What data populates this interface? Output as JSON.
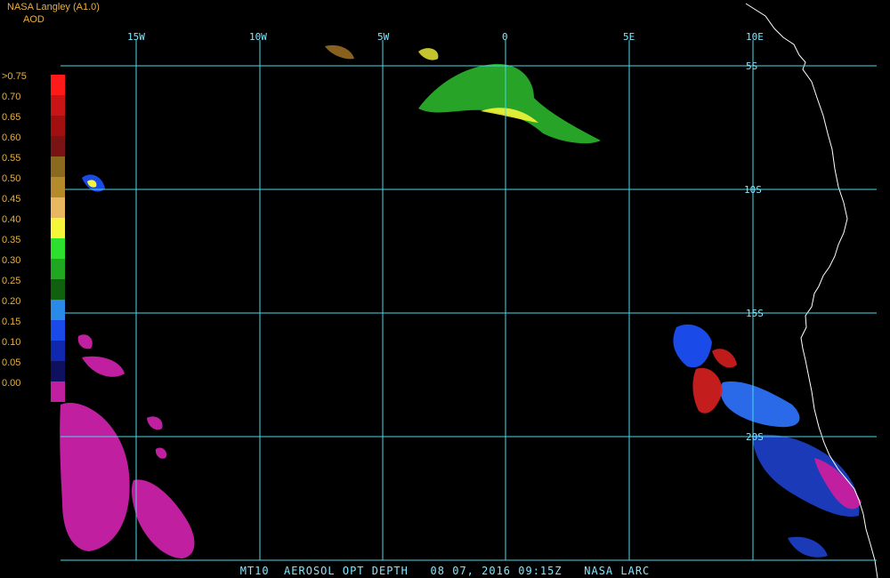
{
  "header": {
    "title": "NASA Langley (A1.0)",
    "unit": "AOD"
  },
  "legend": {
    "labels": [
      ">0.75",
      "0.70",
      "0.65",
      "0.60",
      "0.55",
      "0.50",
      "0.45",
      "0.40",
      "0.35",
      "0.30",
      "0.25",
      "0.20",
      "0.15",
      "0.10",
      "0.05",
      "0.00"
    ],
    "colors": [
      "#ff1a1a",
      "#c81414",
      "#a01010",
      "#7a1414",
      "#8a6a1e",
      "#b58a2a",
      "#e8b860",
      "#f5f53a",
      "#2ee02e",
      "#1fa81f",
      "#106010",
      "#2a8ae8",
      "#1a4ae8",
      "#1028b0",
      "#101060",
      "#c020a0"
    ]
  },
  "grid": {
    "longitudes": [
      "15W",
      "10W",
      "5W",
      "0",
      "5E",
      "10E"
    ],
    "latitudes": [
      "5S",
      "10S",
      "15S",
      "20S"
    ]
  },
  "footer": {
    "text": "MT10  AEROSOL OPT DEPTH   08 07, 2016 09:15Z   NASA LARC"
  }
}
